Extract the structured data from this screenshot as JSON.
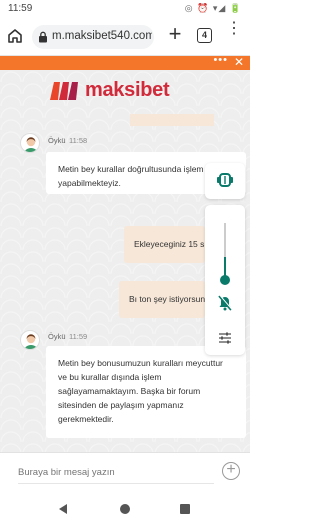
{
  "status_bar": {
    "time": "11:59",
    "icons": "◎ ⏰ ▾◢ 🔋"
  },
  "browser": {
    "url": "m.maksibet540.com",
    "tab_count": "4",
    "icons": [
      "home-icon",
      "lock-icon",
      "plus-icon",
      "tabs-icon",
      "more-vert-icon"
    ]
  },
  "chat_header": {
    "menu_glyph": "•••",
    "close_glyph": "✕",
    "color": "#f4762a"
  },
  "brand": {
    "name": "maksibet",
    "color": "#d12a3a"
  },
  "messages": [
    {
      "type": "incoming",
      "name": "Öykü",
      "time": "11:58",
      "text": "Metin bey kurallar doğrultusunda işlem yapabilmekteyiz."
    },
    {
      "type": "outgoing",
      "text": "Ekleyeceginiz 15 s"
    },
    {
      "type": "outgoing",
      "text": "Bı ton şey istiyorsun"
    },
    {
      "type": "incoming",
      "name": "Öykü",
      "time": "11:59",
      "text": "Metin bey bonusumuzun kuralları meycuttur ve bu kurallar dışında işlem sağlayamamaktayım. Başka bir forum sitesinden de paylaşım yapmanız gerekmektedir."
    }
  ],
  "side_controls": {
    "volume_level": 0.4,
    "icons": [
      "ear-icon",
      "muted-bell-icon",
      "tune-icon"
    ],
    "accent": "#0a7a6a"
  },
  "composer": {
    "placeholder": "Buraya bir mesaj yazın",
    "add_glyph": "+"
  },
  "nav": {
    "icons": [
      "back-icon",
      "home-circle-icon",
      "recents-icon"
    ]
  }
}
